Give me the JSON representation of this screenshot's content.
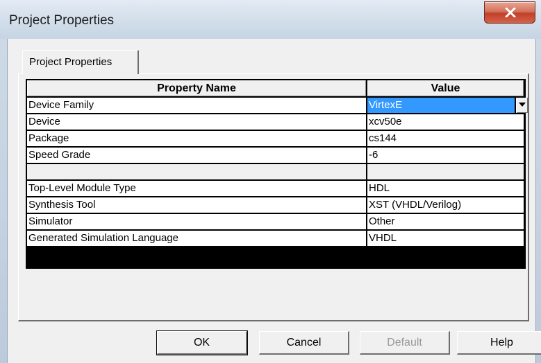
{
  "window": {
    "title": "Project Properties"
  },
  "tab": {
    "label": "Project Properties"
  },
  "table": {
    "headers": {
      "name": "Property Name",
      "value": "Value"
    },
    "rows": [
      {
        "name": "Device Family",
        "value": "VirtexE"
      },
      {
        "name": "Device",
        "value": "xcv50e"
      },
      {
        "name": "Package",
        "value": "cs144"
      },
      {
        "name": "Speed Grade",
        "value": "-6"
      },
      {
        "name": "",
        "value": ""
      },
      {
        "name": "Top-Level Module Type",
        "value": "HDL"
      },
      {
        "name": "Synthesis Tool",
        "value": "XST (VHDL/Verilog)"
      },
      {
        "name": "Simulator",
        "value": "Other"
      },
      {
        "name": "Generated Simulation Language",
        "value": "VHDL"
      }
    ],
    "selected_row": 0
  },
  "buttons": {
    "ok": "OK",
    "cancel": "Cancel",
    "default": "Default",
    "help": "Help"
  },
  "colors": {
    "selection": "#3399ff",
    "close_button": "#c2402a"
  },
  "icons": {
    "close": "close-x-icon",
    "dropdown": "chevron-down-icon"
  }
}
